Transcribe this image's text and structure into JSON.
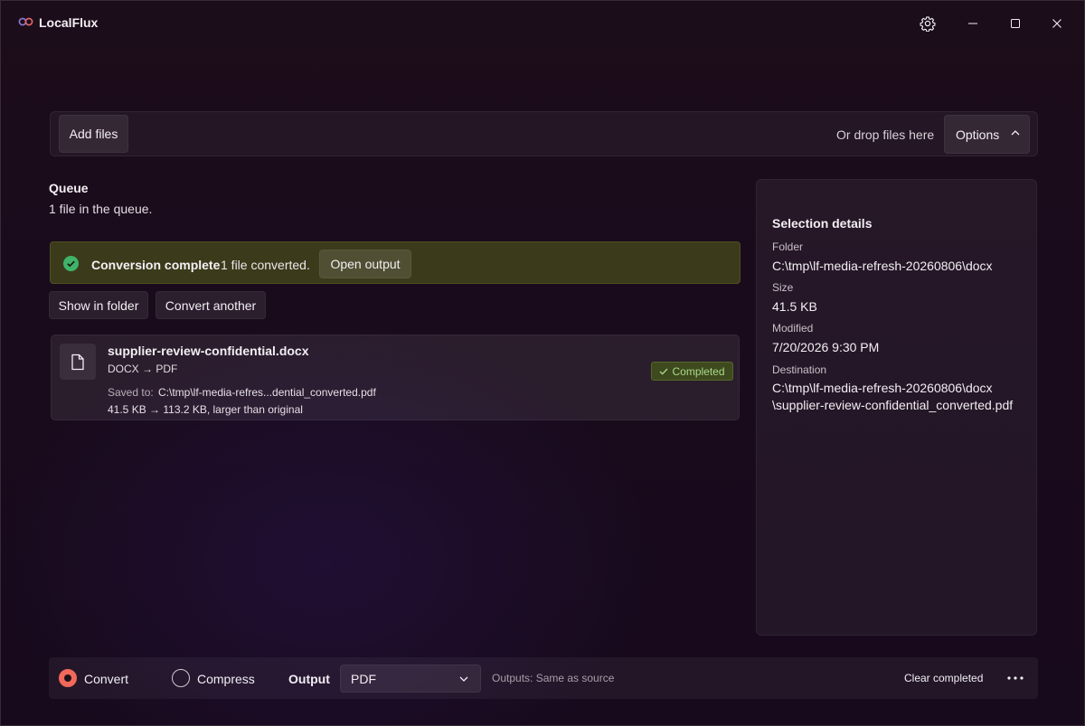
{
  "app": {
    "title": "LocalFlux"
  },
  "toolbar": {
    "add_files_label": "Add files",
    "drop_hint": "Or drop files here",
    "options_label": "Options"
  },
  "queue": {
    "title": "Queue",
    "subtitle": "1 file in the queue."
  },
  "banner": {
    "title": "Conversion complete",
    "message": "1 file converted.",
    "open_output_label": "Open output"
  },
  "actions": {
    "show_in_folder_label": "Show in folder",
    "convert_another_label": "Convert another"
  },
  "files": [
    {
      "name": "supplier-review-confidential.docx",
      "conversion": "DOCX → PDF",
      "saved_label": "Saved to:",
      "saved_path": "C:\\tmp\\lf-media-refres...dential_converted.pdf",
      "size_info": "41.5 KB → 113.2 KB, larger than original",
      "status": "Completed",
      "status_color": "#a9d98a"
    }
  ],
  "details": {
    "title": "Selection details",
    "folder_label": "Folder",
    "folder_value": "C:\\tmp\\lf-media-refresh-20260806\\docx",
    "size_label": "Size",
    "size_value": "41.5 KB",
    "modified_label": "Modified",
    "modified_value": "7/20/2026 9:30 PM",
    "destination_label": "Destination",
    "destination_line1": "C:\\tmp\\lf-media-refresh-20260806\\docx",
    "destination_line2": "\\supplier-review-confidential_converted.pdf"
  },
  "bottom": {
    "mode_convert_label": "Convert",
    "mode_compress_label": "Compress",
    "selected_mode": "Convert",
    "output_label": "Output",
    "output_format": "PDF",
    "outputs_note": "Outputs: Same as source",
    "clear_completed_label": "Clear completed"
  },
  "colors": {
    "accent": "#f0695a",
    "success": "#3fb36a",
    "banner_bg": "#3b3a1a"
  }
}
